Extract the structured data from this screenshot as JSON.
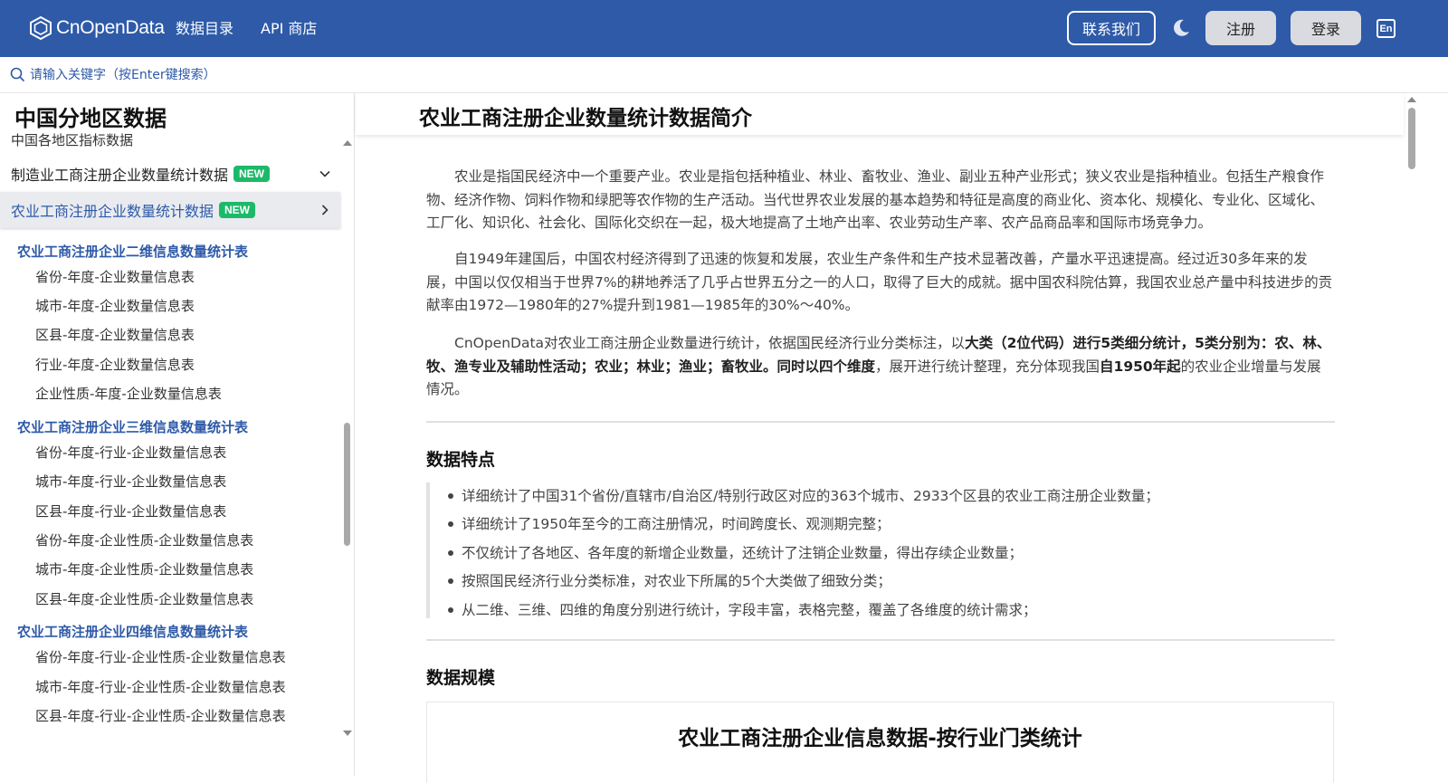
{
  "header": {
    "logo_text": "CnOpenData",
    "nav": [
      "数据目录",
      "API 商店"
    ],
    "contact_label": "联系我们",
    "register_label": "注册",
    "login_label": "登录",
    "lang_label": "En"
  },
  "search": {
    "placeholder": "请输入关键字（按Enter键搜索）"
  },
  "sidebar": {
    "title": "中国分地区数据",
    "cut_item": "中国各地区指标数据",
    "rows": [
      {
        "label": "制造业工商注册企业数量统计数据",
        "badge": "NEW"
      },
      {
        "label": "农业工商注册企业数量统计数据",
        "badge": "NEW"
      }
    ],
    "groups": [
      {
        "label": "农业工商注册企业二维信息数量统计表",
        "items": [
          "省份-年度-企业数量信息表",
          "城市-年度-企业数量信息表",
          "区县-年度-企业数量信息表",
          "行业-年度-企业数量信息表",
          "企业性质-年度-企业数量信息表"
        ]
      },
      {
        "label": "农业工商注册企业三维信息数量统计表",
        "items": [
          "省份-年度-行业-企业数量信息表",
          "城市-年度-行业-企业数量信息表",
          "区县-年度-行业-企业数量信息表",
          "省份-年度-企业性质-企业数量信息表",
          "城市-年度-企业性质-企业数量信息表",
          "区县-年度-企业性质-企业数量信息表"
        ]
      },
      {
        "label": "农业工商注册企业四维信息数量统计表",
        "items": [
          "省份-年度-行业-企业性质-企业数量信息表",
          "城市-年度-行业-企业性质-企业数量信息表",
          "区县-年度-行业-企业性质-企业数量信息表"
        ]
      }
    ]
  },
  "main": {
    "title": "农业工商注册企业数量统计数据简介",
    "para1": "农业是指国民经济中一个重要产业。农业是指包括种植业、林业、畜牧业、渔业、副业五种产业形式；狭义农业是指种植业。包括生产粮食作物、经济作物、饲料作物和绿肥等农作物的生产活动。当代世界农业发展的基本趋势和特征是高度的商业化、资本化、规模化、专业化、区域化、工厂化、知识化、社会化、国际化交织在一起，极大地提高了土地产出率、农业劳动生产率、农产品商品率和国际市场竞争力。",
    "para2": "自1949年建国后，中国农村经济得到了迅速的恢复和发展，农业生产条件和生产技术显著改善，产量水平迅速提高。经过近30多年来的发展，中国以仅仅相当于世界7%的耕地养活了几乎占世界五分之一的人口，取得了巨大的成就。据中国农科院估算，我国农业总产量中科技进步的贡献率由1972—1980年的27%提升到1981—1985年的30%～40%。",
    "para3": {
      "t1": "CnOpenData对农业工商注册企业数量进行统计，依据国民经济行业分类标注，以",
      "b1": "大类（2位代码）进行5类细分统计，5类分别为：农、林、牧、渔专业及辅助性活动；农业；林业；渔业；畜牧业。同时以四个维度",
      "t2": "，展开进行统计整理，充分体现我国",
      "b2": "自1950年起",
      "t3": "的农业企业增量与发展情况。"
    },
    "features_title": "数据特点",
    "features": [
      "详细统计了中国31个省份/直辖市/自治区/特别行政区对应的363个城市、2933个区县的农业工商注册企业数量；",
      "详细统计了1950年至今的工商注册情况，时间跨度长、观测期完整；",
      "不仅统计了各地区、各年度的新增企业数量，还统计了注销企业数量，得出存续企业数量；",
      "按照国民经济行业分类标准，对农业下所属的5个大类做了细致分类；",
      "从二维、三维、四维的角度分别进行统计，字段丰富，表格完整，覆盖了各维度的统计需求；"
    ],
    "scale_title": "数据规模",
    "table_title": "农业工商注册企业信息数据-按行业门类统计"
  },
  "colors": {
    "brand": "#2e5aa8",
    "badge": "#1db96a"
  }
}
